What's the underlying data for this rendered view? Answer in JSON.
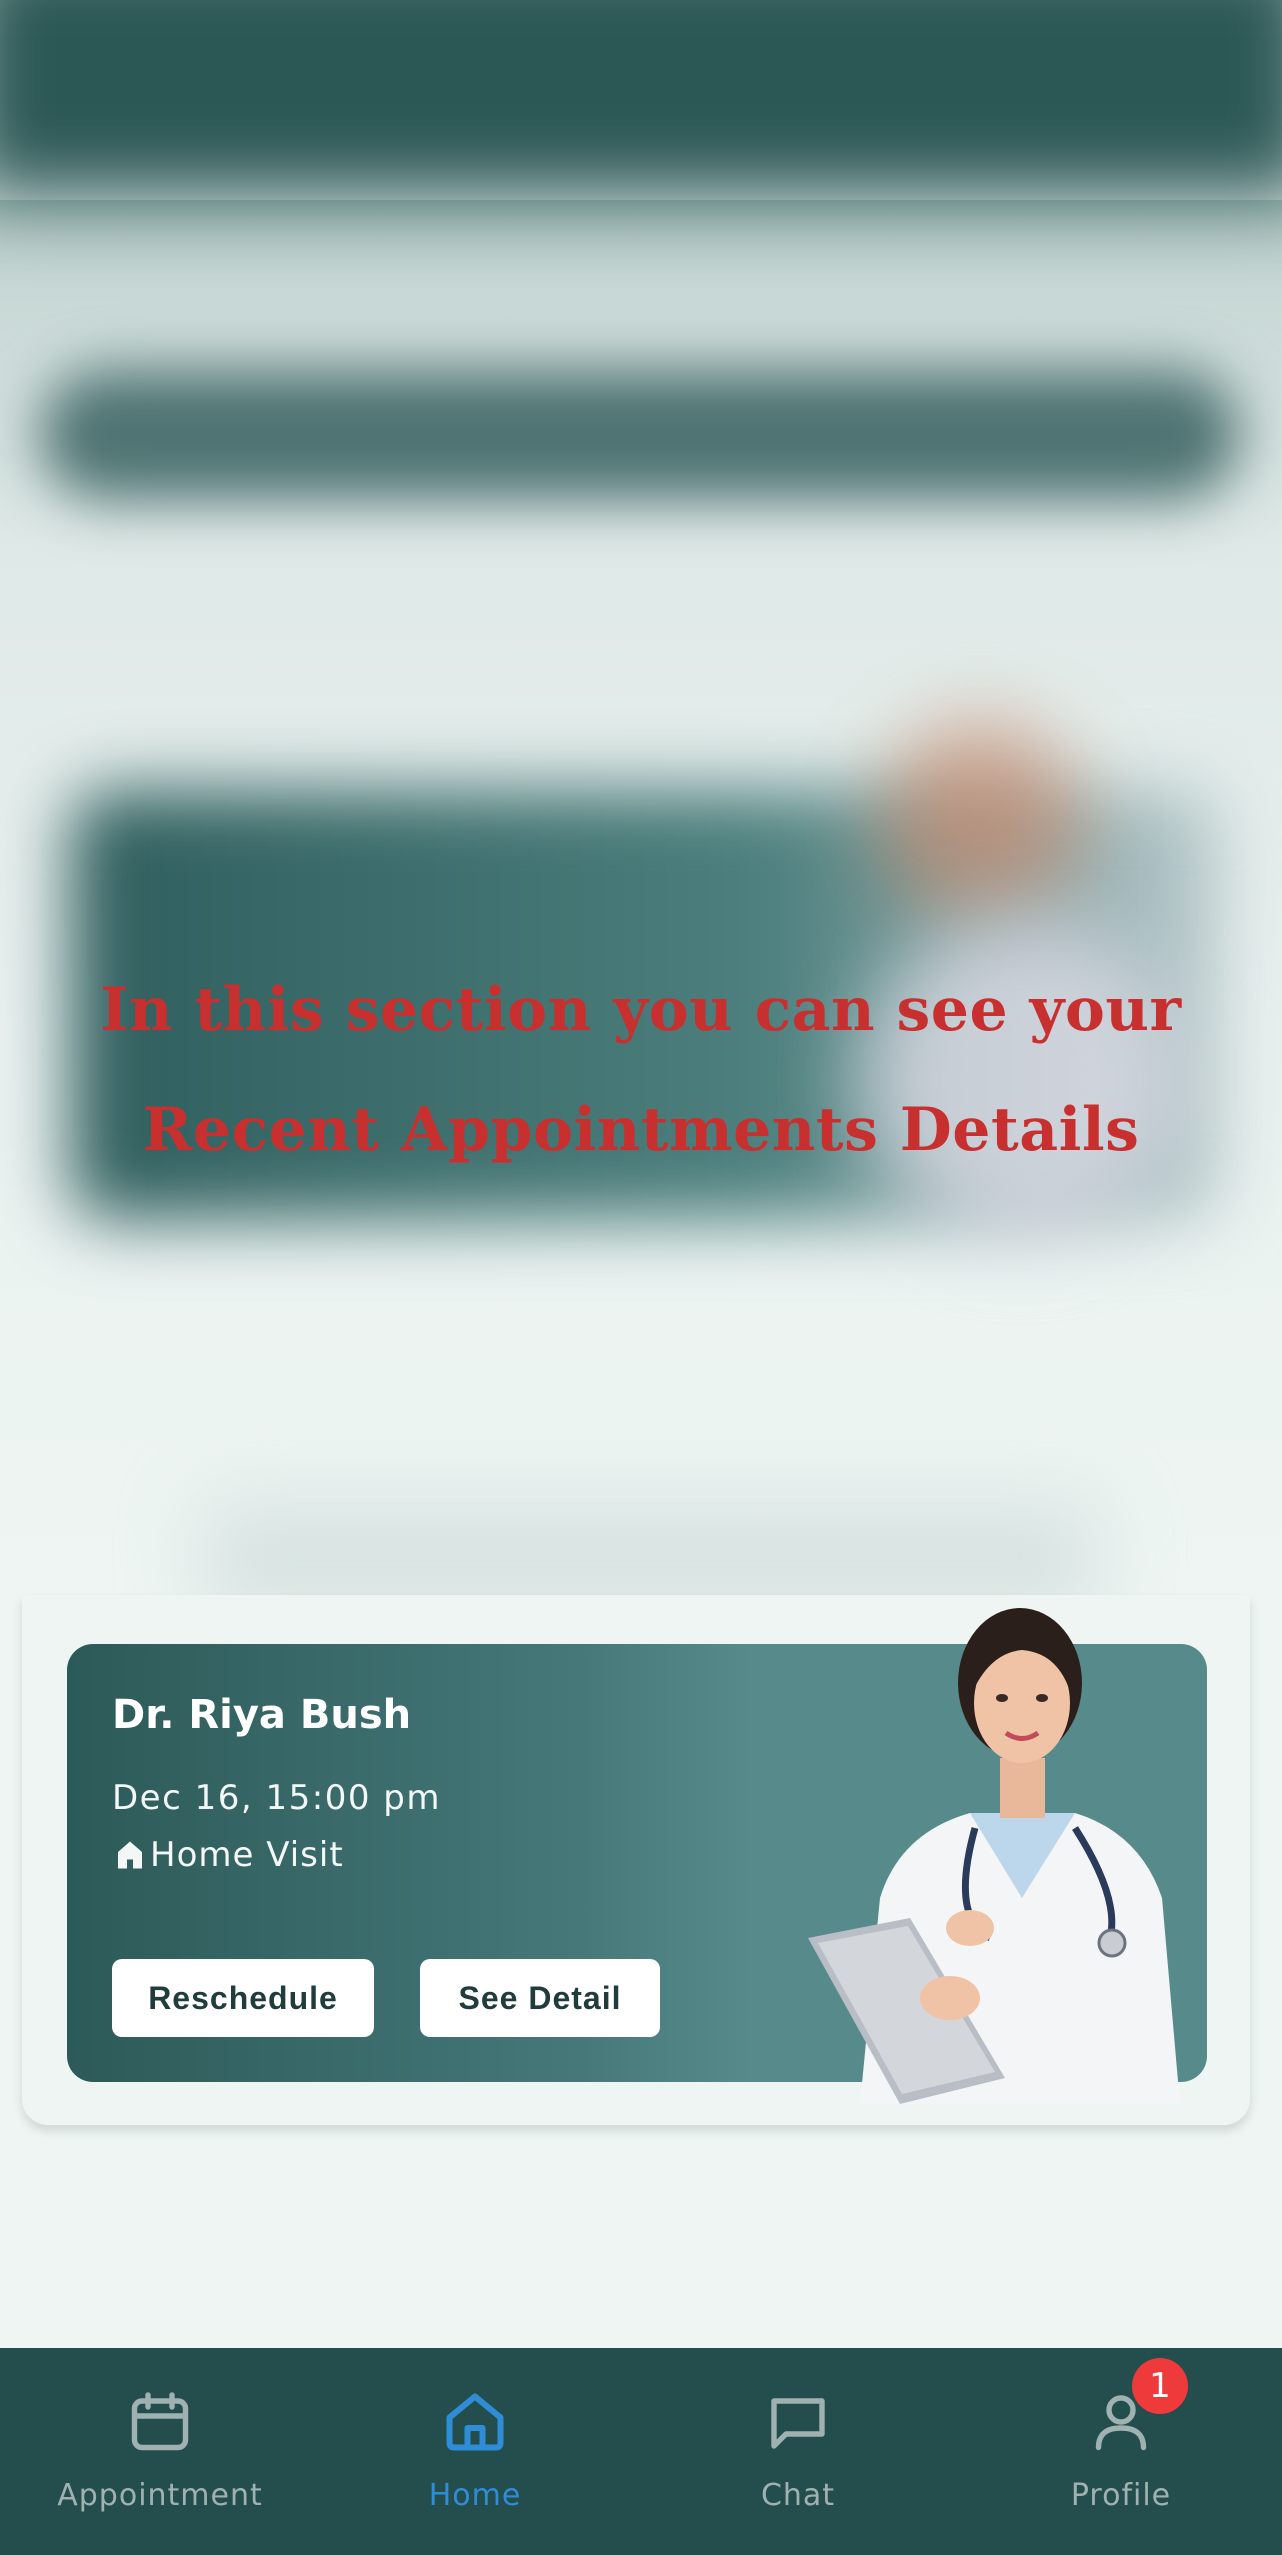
{
  "overlay": {
    "line1": "In this section you can see your",
    "line2": "Recent Appointments Details",
    "color": "#c8302f"
  },
  "appointment": {
    "doctor_name": "Dr. Riya Bush",
    "datetime": "Dec 16, 15:00 pm",
    "visit_type": "Home Visit",
    "visit_icon": "home-icon",
    "reschedule_label": "Reschedule",
    "detail_label": "See Detail",
    "card_colors": [
      "#2c5a58",
      "#578b8b"
    ]
  },
  "tabbar": {
    "background": "#244d4d",
    "active_color": "#2f8dd6",
    "tabs": [
      {
        "label": "Appointment",
        "icon": "calendar-icon"
      },
      {
        "label": "Home",
        "icon": "home-icon",
        "active": true
      },
      {
        "label": "Chat",
        "icon": "chat-icon"
      },
      {
        "label": "Profile",
        "icon": "profile-icon",
        "badge": "1"
      }
    ]
  }
}
